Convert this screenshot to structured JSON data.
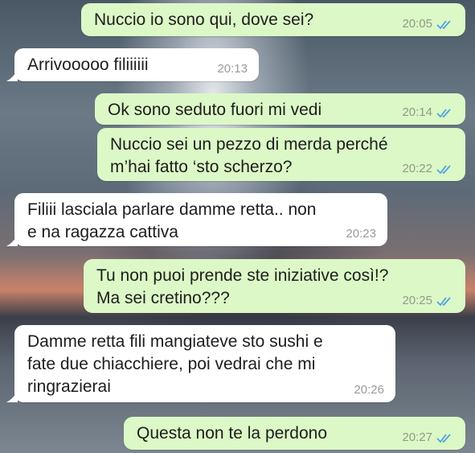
{
  "messages": [
    {
      "dir": "out",
      "text": "Nuccio io sono qui, dove sei?",
      "time": "20:05",
      "ticks": "read"
    },
    {
      "dir": "in",
      "text": "Arrivooooo filiiiiii",
      "time": "20:13"
    },
    {
      "dir": "out",
      "text": "Ok sono seduto fuori mi vedi",
      "time": "20:14",
      "ticks": "read"
    },
    {
      "dir": "out",
      "text": "Nuccio sei un pezzo di merda perché\nm’hai fatto ‘sto scherzo?",
      "time": "20:22",
      "ticks": "read"
    },
    {
      "dir": "in",
      "text": "Filiii lasciala parlare damme retta.. non\ne na ragazza cattiva",
      "time": "20:23"
    },
    {
      "dir": "out",
      "text": "Tu non puoi prende ste iniziative così!?\nMa sei cretino???",
      "time": "20:25",
      "ticks": "read"
    },
    {
      "dir": "in",
      "text": "Damme retta fili mangiateve sto sushi e\nfate due chiacchiere, poi vedrai che mi\nringrazierai",
      "time": "20:26"
    },
    {
      "dir": "out",
      "text": "Questa non te la perdono",
      "time": "20:27",
      "ticks": "read"
    }
  ],
  "colors": {
    "outgoing_bubble": "#dcf8c6",
    "incoming_bubble": "#ffffff",
    "read_ticks": "#4fa3e0"
  },
  "icons": {
    "read_receipt": "double-check-icon"
  }
}
